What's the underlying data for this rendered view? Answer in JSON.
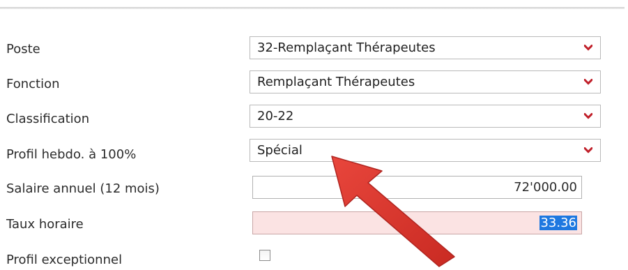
{
  "form": {
    "fields": [
      {
        "label": "Poste",
        "value": "32-Remplaçant Thérapeutes"
      },
      {
        "label": "Fonction",
        "value": "Remplaçant Thérapeutes"
      },
      {
        "label": "Classification",
        "value": "20-22"
      },
      {
        "label": "Profil hebdo. à 100%",
        "value": "Spécial"
      },
      {
        "label": "Salaire annuel (12 mois)",
        "value": "72'000.00"
      },
      {
        "label": "Taux horaire",
        "value": "33.36"
      },
      {
        "label": "Profil exceptionnel",
        "value": ""
      }
    ]
  },
  "icons": {
    "dropdown": "chevron-down-icon"
  },
  "colors": {
    "chevron": "#c0202a",
    "arrow": "#d9322b",
    "selection": "#1e78e0",
    "error_field_bg": "#fbe3e3"
  },
  "checkbox": {
    "profil_exceptionnel_checked": false
  }
}
